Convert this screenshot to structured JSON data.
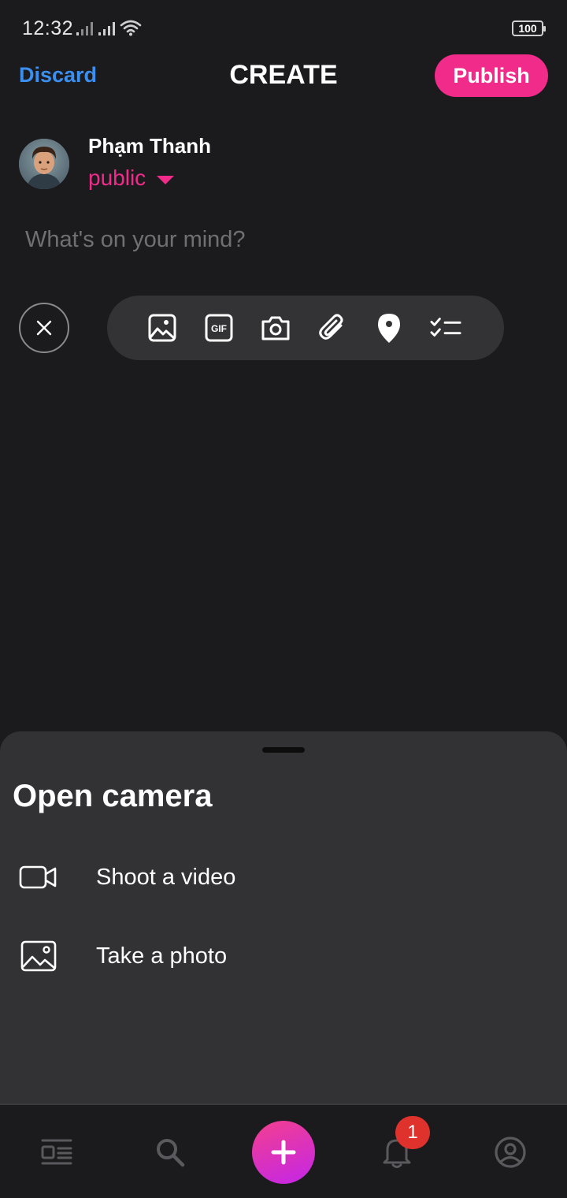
{
  "status_bar": {
    "time": "12:32",
    "battery": "100",
    "icons": [
      "signal-icon",
      "signal-icon",
      "wifi-icon",
      "battery-icon"
    ]
  },
  "header": {
    "discard_label": "Discard",
    "title": "CREATE",
    "publish_label": "Publish"
  },
  "author": {
    "name": "Phạm Thanh",
    "audience": "public"
  },
  "composer": {
    "placeholder": "What's on your mind?"
  },
  "tools": [
    "image-icon",
    "gif-icon",
    "camera-icon",
    "paperclip-icon",
    "location-pin-icon",
    "checklist-icon"
  ],
  "sheet": {
    "title": "Open camera",
    "items": [
      {
        "label": "Shoot a video",
        "icon": "video-camera-icon"
      },
      {
        "label": "Take a photo",
        "icon": "image-icon"
      }
    ]
  },
  "bottom_nav": {
    "items": [
      "feed-icon",
      "search-icon",
      "plus-icon",
      "bell-icon",
      "profile-icon"
    ],
    "notification_count": "1"
  },
  "colors": {
    "accent_pink": "#f02b8a",
    "link_blue": "#3b8ff0",
    "background": "#1b1b1d",
    "sheet_background": "#323234",
    "badge_red": "#e0322d"
  }
}
